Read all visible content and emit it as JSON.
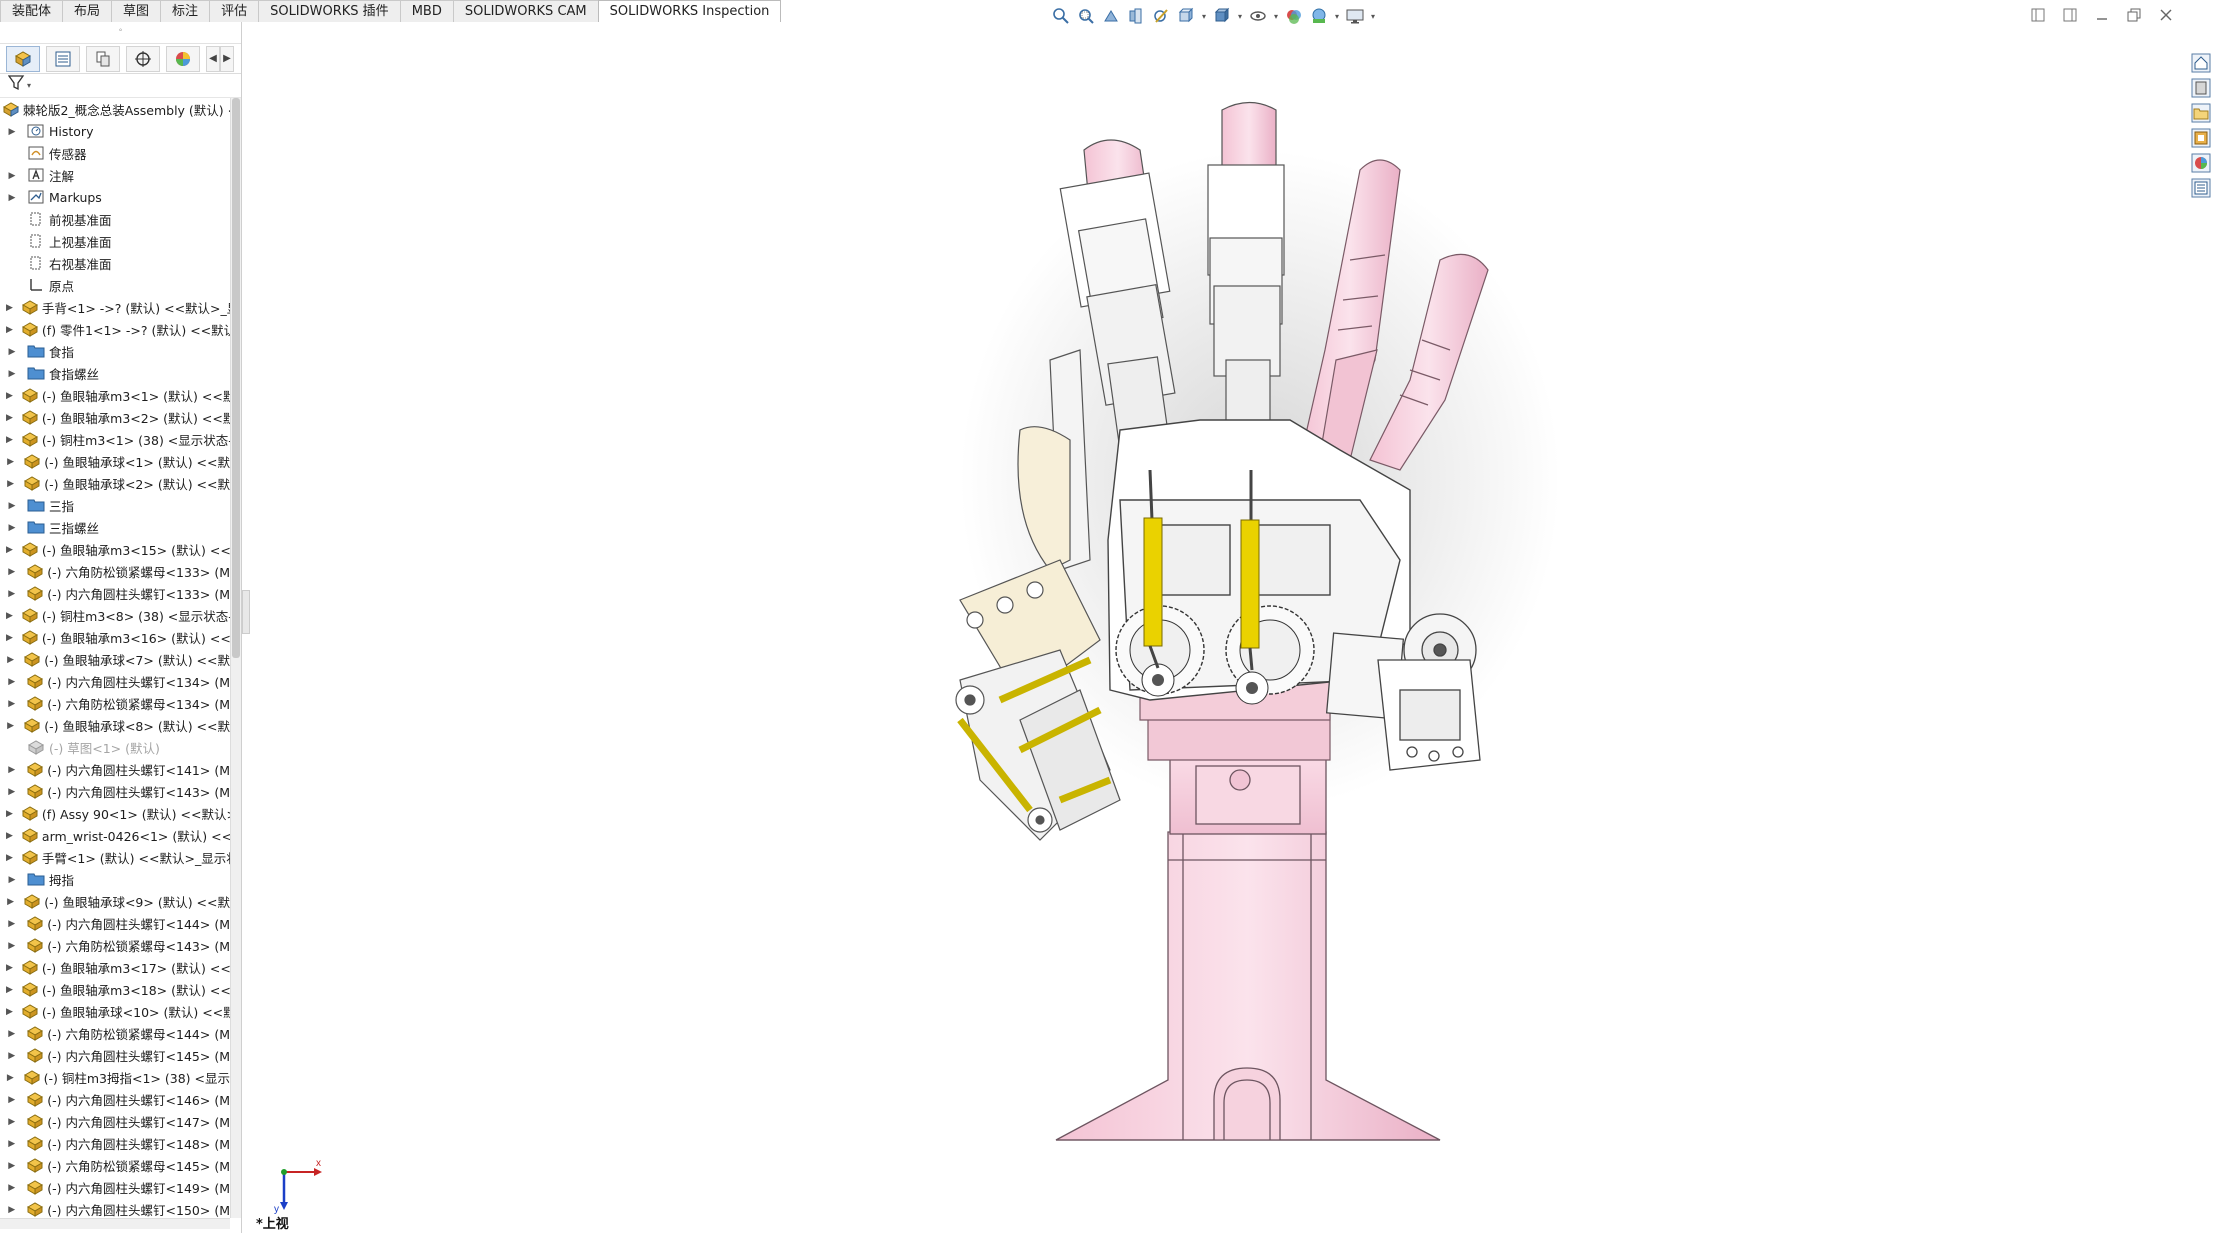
{
  "tabs": [
    {
      "label": "装配体",
      "active": false
    },
    {
      "label": "布局",
      "active": false
    },
    {
      "label": "草图",
      "active": false
    },
    {
      "label": "标注",
      "active": false
    },
    {
      "label": "评估",
      "active": false
    },
    {
      "label": "SOLIDWORKS 插件",
      "active": false
    },
    {
      "label": "MBD",
      "active": false
    },
    {
      "label": "SOLIDWORKS CAM",
      "active": false
    },
    {
      "label": "SOLIDWORKS Inspection",
      "active": true
    }
  ],
  "hud_tools": [
    "zoom-to-fit-icon",
    "zoom-to-area-icon",
    "previous-view-icon",
    "section-view-icon",
    "dynamic-annotation-icon",
    "view-orientation-icon",
    "display-style-icon",
    "hide-show-items-icon",
    "edit-appearance-icon",
    "apply-scene-icon",
    "view-settings-icon"
  ],
  "feature_tree": {
    "root": "棘轮版2_概念总装Assembly (默认) <",
    "items": [
      {
        "label": "History",
        "icon": "history-folder-icon",
        "expand": true,
        "grey": false
      },
      {
        "label": "传感器",
        "icon": "sensor-icon",
        "expand": false,
        "grey": false
      },
      {
        "label": "注解",
        "icon": "annotation-icon",
        "expand": true,
        "grey": false
      },
      {
        "label": "Markups",
        "icon": "markups-icon",
        "expand": true,
        "grey": false
      },
      {
        "label": "前视基准面",
        "icon": "plane-icon",
        "expand": false,
        "grey": false
      },
      {
        "label": "上视基准面",
        "icon": "plane-icon",
        "expand": false,
        "grey": false
      },
      {
        "label": "右视基准面",
        "icon": "plane-icon",
        "expand": false,
        "grey": false
      },
      {
        "label": "原点",
        "icon": "origin-icon",
        "expand": false,
        "grey": false
      },
      {
        "label": "手背<1> ->? (默认) <<默认>_显",
        "icon": "part-icon",
        "expand": true,
        "grey": false
      },
      {
        "label": "(f) 零件1<1> ->? (默认) <<默认",
        "icon": "part-icon",
        "expand": true,
        "grey": false
      },
      {
        "label": "食指",
        "icon": "folder-icon",
        "expand": true,
        "grey": false
      },
      {
        "label": "食指螺丝",
        "icon": "folder-icon",
        "expand": true,
        "grey": false
      },
      {
        "label": "(-) 鱼眼轴承m3<1> (默认) <<默",
        "icon": "part-icon",
        "expand": true,
        "grey": false
      },
      {
        "label": "(-) 鱼眼轴承m3<2> (默认) <<默",
        "icon": "part-icon",
        "expand": true,
        "grey": false
      },
      {
        "label": "(-) 铜柱m3<1> (38) <显示状态-",
        "icon": "part-icon",
        "expand": true,
        "grey": false
      },
      {
        "label": "(-) 鱼眼轴承球<1> (默认) <<默",
        "icon": "part-icon",
        "expand": true,
        "grey": false
      },
      {
        "label": "(-) 鱼眼轴承球<2> (默认) <<默",
        "icon": "part-icon",
        "expand": true,
        "grey": false
      },
      {
        "label": "三指",
        "icon": "folder-icon",
        "expand": true,
        "grey": false
      },
      {
        "label": "三指螺丝",
        "icon": "folder-icon",
        "expand": true,
        "grey": false
      },
      {
        "label": "(-) 鱼眼轴承m3<15> (默认) <<",
        "icon": "part-icon",
        "expand": true,
        "grey": false
      },
      {
        "label": "(-) 六角防松锁紧螺母<133> (M",
        "icon": "part-icon",
        "expand": true,
        "grey": false
      },
      {
        "label": "(-) 内六角圆柱头螺钉<133> (M",
        "icon": "part-icon",
        "expand": true,
        "grey": false
      },
      {
        "label": "(-) 铜柱m3<8> (38) <显示状态-",
        "icon": "part-icon",
        "expand": true,
        "grey": false
      },
      {
        "label": "(-) 鱼眼轴承m3<16> (默认) <<",
        "icon": "part-icon",
        "expand": true,
        "grey": false
      },
      {
        "label": "(-) 鱼眼轴承球<7> (默认) <<默",
        "icon": "part-icon",
        "expand": true,
        "grey": false
      },
      {
        "label": "(-) 内六角圆柱头螺钉<134> (M",
        "icon": "part-icon",
        "expand": true,
        "grey": false
      },
      {
        "label": "(-) 六角防松锁紧螺母<134> (M",
        "icon": "part-icon",
        "expand": true,
        "grey": false
      },
      {
        "label": "(-) 鱼眼轴承球<8> (默认) <<默",
        "icon": "part-icon",
        "expand": true,
        "grey": false
      },
      {
        "label": "(-) 草图<1> (默认)",
        "icon": "part-icon",
        "expand": false,
        "grey": true
      },
      {
        "label": "(-) 内六角圆柱头螺钉<141> (M",
        "icon": "part-icon",
        "expand": true,
        "grey": false
      },
      {
        "label": "(-) 内六角圆柱头螺钉<143> (M",
        "icon": "part-icon",
        "expand": true,
        "grey": false
      },
      {
        "label": "(f) Assy 90<1> (默认) <<默认>",
        "icon": "part-icon",
        "expand": true,
        "grey": false
      },
      {
        "label": "arm_wrist-0426<1> (默认) <<默",
        "icon": "part-icon",
        "expand": true,
        "grey": false
      },
      {
        "label": "手臂<1> (默认) <<默认>_显示状",
        "icon": "part-icon",
        "expand": true,
        "grey": false
      },
      {
        "label": "拇指",
        "icon": "folder-icon",
        "expand": true,
        "grey": false
      },
      {
        "label": "(-) 鱼眼轴承球<9> (默认) <<默",
        "icon": "part-icon",
        "expand": true,
        "grey": false
      },
      {
        "label": "(-) 内六角圆柱头螺钉<144> (M",
        "icon": "part-icon",
        "expand": true,
        "grey": false
      },
      {
        "label": "(-) 六角防松锁紧螺母<143> (M",
        "icon": "part-icon",
        "expand": true,
        "grey": false
      },
      {
        "label": "(-) 鱼眼轴承m3<17> (默认) <<",
        "icon": "part-icon",
        "expand": true,
        "grey": false
      },
      {
        "label": "(-) 鱼眼轴承m3<18> (默认) <<",
        "icon": "part-icon",
        "expand": true,
        "grey": false
      },
      {
        "label": "(-) 鱼眼轴承球<10> (默认) <<默",
        "icon": "part-icon",
        "expand": true,
        "grey": false
      },
      {
        "label": "(-) 六角防松锁紧螺母<144> (M",
        "icon": "part-icon",
        "expand": true,
        "grey": false
      },
      {
        "label": "(-) 内六角圆柱头螺钉<145> (M",
        "icon": "part-icon",
        "expand": true,
        "grey": false
      },
      {
        "label": "(-) 铜柱m3拇指<1> (38) <显示",
        "icon": "part-icon",
        "expand": true,
        "grey": false
      },
      {
        "label": "(-) 内六角圆柱头螺钉<146> (M",
        "icon": "part-icon",
        "expand": true,
        "grey": false
      },
      {
        "label": "(-) 内六角圆柱头螺钉<147> (M",
        "icon": "part-icon",
        "expand": true,
        "grey": false
      },
      {
        "label": "(-) 内六角圆柱头螺钉<148> (M",
        "icon": "part-icon",
        "expand": true,
        "grey": false
      },
      {
        "label": "(-) 六角防松锁紧螺母<145> (M",
        "icon": "part-icon",
        "expand": true,
        "grey": false
      },
      {
        "label": "(-) 内六角圆柱头螺钉<149> (M",
        "icon": "part-icon",
        "expand": true,
        "grey": false
      },
      {
        "label": "(-) 内六角圆柱头螺钉<150> (M",
        "icon": "part-icon",
        "expand": true,
        "grey": false
      }
    ]
  },
  "viewport": {
    "view_label": "*上视",
    "triad_x": "x",
    "triad_y": "y"
  },
  "colors": {
    "model_pink": "#f6cfdc",
    "model_pink_dark": "#e8a9c0",
    "actuator_yellow": "#e6d000",
    "part_yellow": "#f5c44a",
    "tab_active": "#ffffff"
  }
}
